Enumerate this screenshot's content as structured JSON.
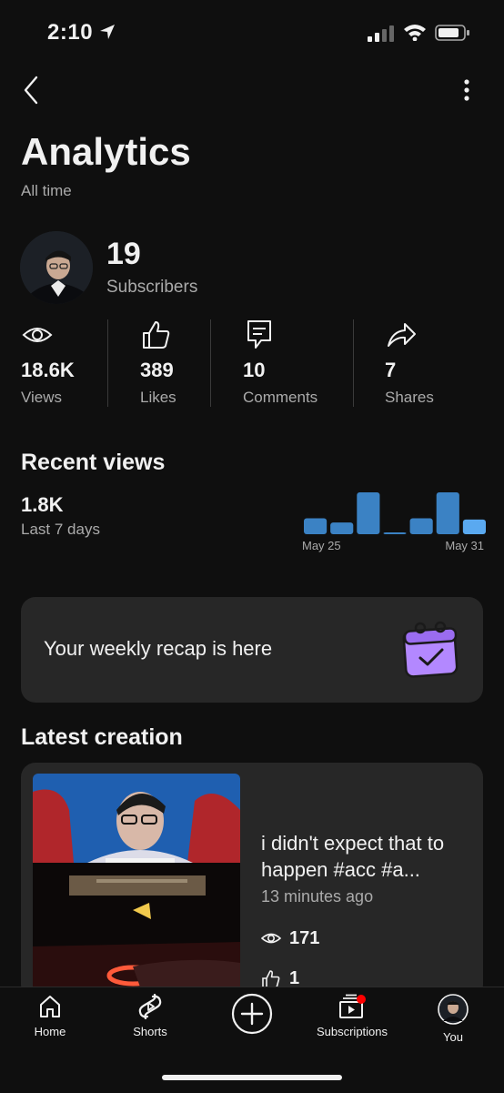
{
  "status_bar": {
    "time": "2:10"
  },
  "header": {
    "title": "Analytics",
    "subtitle": "All time"
  },
  "channel": {
    "subscribers": "19",
    "subscribers_label": "Subscribers"
  },
  "stats": [
    {
      "value": "18.6K",
      "label": "Views",
      "icon": "eye-icon"
    },
    {
      "value": "389",
      "label": "Likes",
      "icon": "thumbs-up-icon"
    },
    {
      "value": "10",
      "label": "Comments",
      "icon": "comment-icon"
    },
    {
      "value": "7",
      "label": "Shares",
      "icon": "share-icon"
    }
  ],
  "recent_views": {
    "title": "Recent views",
    "total": "1.8K",
    "period": "Last 7 days",
    "chart_data": {
      "type": "bar",
      "categories": [
        "May 25",
        "May 26",
        "May 27",
        "May 28",
        "May 29",
        "May 30",
        "May 31"
      ],
      "values": [
        0.38,
        0.28,
        1.0,
        0.04,
        0.38,
        1.0,
        0.35
      ],
      "x_tick_labels": [
        "May 25",
        "May 31"
      ],
      "colors": [
        "#3b82c4",
        "#3b82c4",
        "#3b82c4",
        "#3b82c4",
        "#3b82c4",
        "#3b82c4",
        "#5aa9f0"
      ]
    }
  },
  "recap": {
    "text": "Your weekly recap is here",
    "icon": "calendar-check-icon"
  },
  "latest_creation": {
    "title": "Latest creation",
    "video_title": "i didn't expect that to happen #acc #a...",
    "posted": "13 minutes ago",
    "views": "171",
    "likes": "1"
  },
  "bottom_nav": [
    {
      "label": "Home",
      "icon": "home-icon"
    },
    {
      "label": "Shorts",
      "icon": "shorts-icon"
    },
    {
      "label": "",
      "icon": "create-icon"
    },
    {
      "label": "Subscriptions",
      "icon": "subscriptions-icon"
    },
    {
      "label": "You",
      "icon": "avatar-icon"
    }
  ],
  "colors": {
    "background": "#0f0f0f",
    "card": "#272727",
    "accent_blue": "#3b82c4",
    "recap_purple": "#b388ff",
    "notification_red": "#ff0000"
  }
}
